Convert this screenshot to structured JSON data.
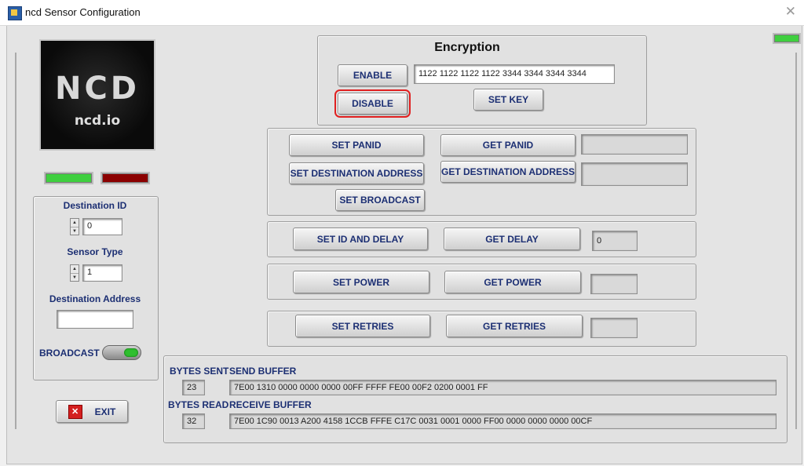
{
  "window": {
    "title": "ncd Sensor Configuration"
  },
  "logo": {
    "brand": "NCD",
    "site": "ncd.io"
  },
  "status_leds": {
    "top_right": "#3fcf3f",
    "left_green": "#3fcf3f",
    "left_red": "#8b0000"
  },
  "encryption": {
    "title": "Encryption",
    "enable_label": "ENABLE",
    "disable_label": "DISABLE",
    "key_value": "1122 1122 1122 1122 3344 3344 3344 3344",
    "set_key_label": "SET KEY"
  },
  "network": {
    "set_panid_label": "SET PANID",
    "get_panid_label": "GET PANID",
    "panid_value": "",
    "set_dest_label": "SET DESTINATION ADDRESS",
    "get_dest_label": "GET DESTINATION ADDRESS",
    "dest_value": "",
    "set_broadcast_label": "SET BROADCAST"
  },
  "delay": {
    "set_label": "SET ID AND DELAY",
    "get_label": "GET DELAY",
    "value": "0"
  },
  "power": {
    "set_label": "SET POWER",
    "get_label": "GET POWER",
    "value": ""
  },
  "retries": {
    "set_label": "SET RETRIES",
    "get_label": "GET RETRIES",
    "value": ""
  },
  "sidebar": {
    "destination_id_label": "Destination ID",
    "destination_id_value": "0",
    "sensor_type_label": "Sensor Type",
    "sensor_type_value": "1",
    "destination_address_label": "Destination Address",
    "destination_address_value": "",
    "broadcast_label": "BROADCAST",
    "exit_label": "EXIT"
  },
  "buffers": {
    "bytes_sent_label": "BYTES SENT",
    "bytes_sent_value": "23",
    "send_buffer_label": "SEND BUFFER",
    "send_buffer_value": "7E00 1310 0000 0000 0000 00FF FFFF FE00 00F2 0200 0001 FF",
    "bytes_read_label": "BYTES READ",
    "bytes_read_value": "32",
    "receive_buffer_label": "RECEIVE BUFFER",
    "receive_buffer_value": "7E00 1C90 0013 A200 4158 1CCB FFFE C17C 0031 0001 0000 FF00 0000 0000 0000 00CF"
  }
}
